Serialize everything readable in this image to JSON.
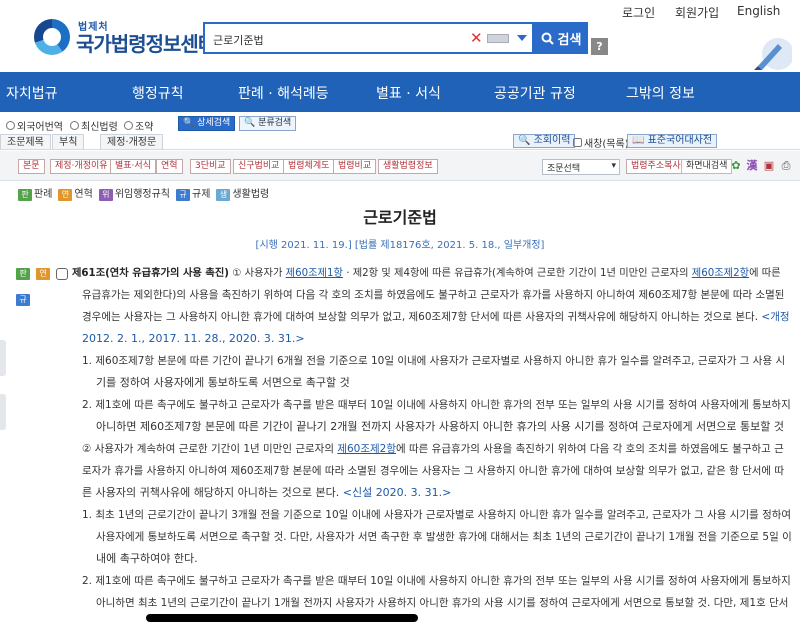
{
  "header": {
    "logo_sub": "법제처",
    "logo_main": "국가법령정보센터",
    "search_value": "근로기준법",
    "search_button": "검색",
    "help": "?",
    "util": [
      "로그인",
      "회원가입",
      "English"
    ]
  },
  "mainnav": [
    "자치법규",
    "행정규칙",
    "판례 · 해석례등",
    "별표 · 서식",
    "공공기관 규정",
    "그밖의 정보"
  ],
  "options": {
    "radios": [
      "외국어번역",
      "최신법령",
      "조약"
    ],
    "buttons": [
      "상세검색",
      "분류검색"
    ]
  },
  "tabs": {
    "items": [
      "조문제목",
      "부칙",
      "제정·개정문"
    ],
    "right": [
      "조회이력",
      "새창(목록)",
      "표준국어대사전"
    ]
  },
  "toolbar": {
    "buttons": [
      "본문",
      "제정·개정이유",
      "별표·서식",
      "연혁",
      "3단비교",
      "신구법비교",
      "법령체계도",
      "법령비교",
      "생활법령정보"
    ],
    "select": "조문선택",
    "right_buttons": [
      "법령주소복사",
      "화면내검색"
    ]
  },
  "legend": [
    {
      "badge": "판",
      "label": "판례",
      "color": "#54a24a"
    },
    {
      "badge": "연",
      "label": "연혁",
      "color": "#e0962a"
    },
    {
      "badge": "위",
      "label": "위임행정규칙",
      "color": "#8c5fb5"
    },
    {
      "badge": "규",
      "label": "규제",
      "color": "#3d7bd0"
    },
    {
      "badge": "생",
      "label": "생활법령",
      "color": "#6aa9d3"
    }
  ],
  "law": {
    "title": "근로기준법",
    "subtitle": "[시행 2021. 11. 19.] [법률 제18176호, 2021. 5. 18., 일부개정]",
    "article_title": "제61조(연차 유급휴가의 사용 촉진)",
    "p1_a": "① 사용자가 ",
    "p1_link1": "제60조제1항",
    "p1_b": " · 제2항 및 제4항에 따른 유급휴가(계속하여 근로한 기간이 1년 미만인 근로자의 ",
    "p1_link2": "제60조제2항",
    "p1_c": "에 따른",
    "p1_l2": "유급휴가는 제외한다)의 사용을 촉진하기 위하여 다음 각 호의 조치를 하였음에도 불구하고 근로자가 휴가를 사용하지 아니하여 제60조제7항 본문에 따라 소멸된",
    "p1_l3a": "경우에는 사용자는 그 사용하지 아니한 휴가에 대하여 보상할 의무가 없고, 제60조제7항 단서에 따른 사용자의 귀책사유에 해당하지 아니하는 것으로 본다. ",
    "p1_l3b": "<개정",
    "p1_l4": "2012. 2. 1., 2017. 11. 28., 2020. 3. 31.>",
    "i1_l1": "1. 제60조제7항 본문에 따른 기간이 끝나기 6개월 전을 기준으로 10일 이내에 사용자가 근로자별로 사용하지 아니한 휴가 일수를 알려주고, 근로자가 그 사용 시",
    "i1_l2": "기를 정하여 사용자에게 통보하도록 서면으로 촉구할 것",
    "i2_l1": "2. 제1호에 따른 촉구에도 불구하고 근로자가 촉구를 받은 때부터 10일 이내에 사용하지 아니한 휴가의 전부 또는 일부의 사용 시기를 정하여 사용자에게 통보하지",
    "i2_l2": "아니하면 제60조제7항 본문에 따른 기간이 끝나기 2개월 전까지 사용자가 사용하지 아니한 휴가의 사용 시기를 정하여 근로자에게 서면으로 통보할 것",
    "p2_a": "② 사용자가 계속하여 근로한 기간이 1년 미만인 근로자의 ",
    "p2_link": "제60조제2항",
    "p2_b": "에 따른 유급휴가의 사용을 촉진하기 위하여 다음 각 호의 조치를 하였음에도 불구하고 근",
    "p2_l2": "로자가 휴가를 사용하지 아니하여 제60조제7항 본문에 따라 소멸된 경우에는 사용자는 그 사용하지 아니한 휴가에 대하여 보상할 의무가 없고, 같은 항 단서에 따",
    "p2_l3a": "른 사용자의 귀책사유에 해당하지 아니하는 것으로 본다. ",
    "p2_l3b": "<신설 2020. 3. 31.>",
    "j1_l1": "1. 최초 1년의 근로기간이 끝나기 3개월 전을 기준으로 10일 이내에 사용자가 근로자별로 사용하지 아니한 휴가 일수를 알려주고, 근로자가 그 사용 시기를 정하여",
    "j1_l2": "사용자에게 통보하도록 서면으로 촉구할 것. 다만, 사용자가 서면 촉구한 후 발생한 휴가에 대해서는 최초 1년의 근로기간이 끝나기 1개월 전을 기준으로 5일 이",
    "j1_l3": "내에 촉구하여야 한다.",
    "j2_l1": "2. 제1호에 따른 촉구에도 불구하고 근로자가 촉구를 받은 때부터 10일 이내에 사용하지 아니한 휴가의 전부 또는 일부의 사용 시기를 정하여 사용자에게 통보하지",
    "j2_l2": "아니하면 최초 1년의 근로기간이 끝나기 1개월 전까지 사용자가 사용하지 아니한 휴가의 사용 시기를 정하여 근로자에게 서면으로 통보할 것. 다만, 제1호 단서"
  }
}
